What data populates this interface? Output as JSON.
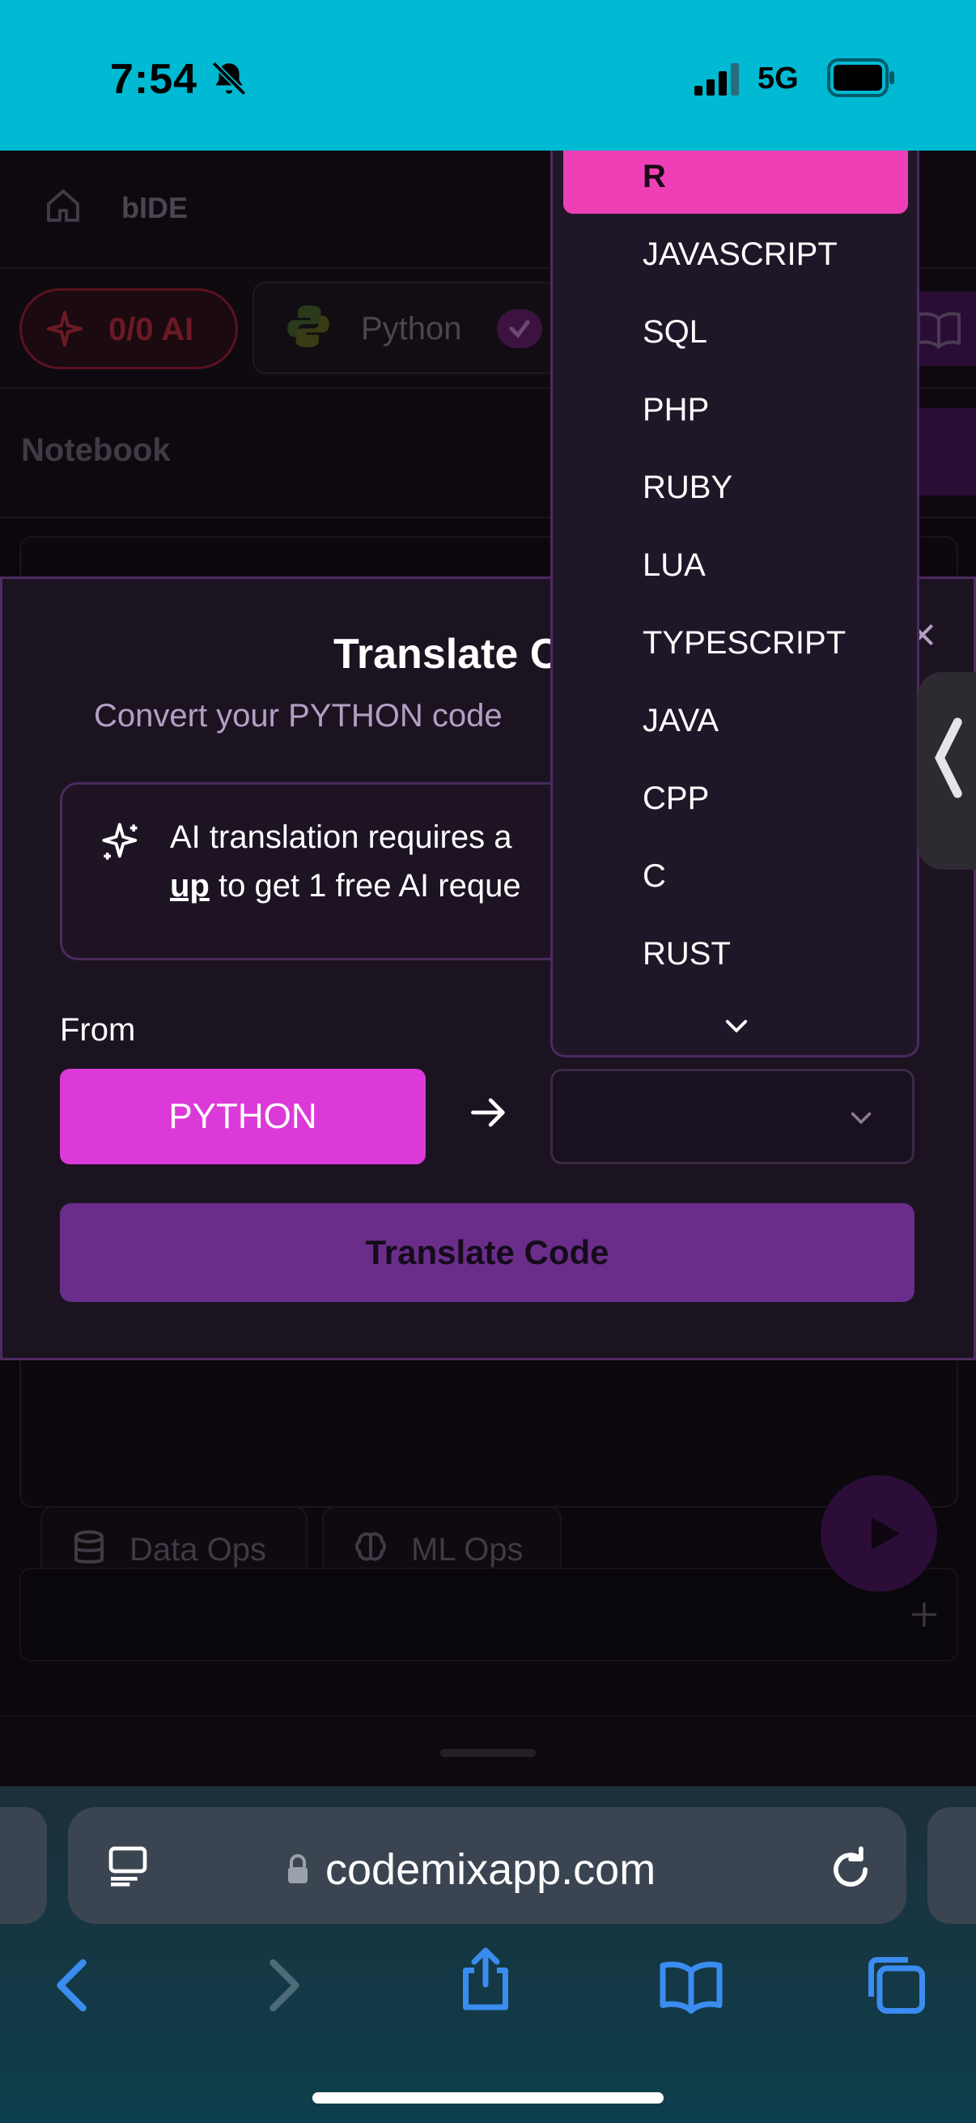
{
  "status_bar": {
    "time": "7:54",
    "network": "5G"
  },
  "app": {
    "title": "bIDE",
    "ai_counter": "0/0 AI",
    "language_chip": "Python",
    "notebook_title": "Notebook",
    "chips": {
      "data_ops": "Data Ops",
      "ml_ops": "ML Ops"
    }
  },
  "modal": {
    "title": "Translate C",
    "subtitle": "Convert your PYTHON code",
    "info_line_1": "AI translation requires a",
    "info_link": "up",
    "info_line_2_rest": " to get 1 free AI reque",
    "from_label": "From",
    "from_value": "PYTHON",
    "to_value": "",
    "translate_button": "Translate Code"
  },
  "dropdown": {
    "selected": "R",
    "items": [
      "JAVASCRIPT",
      "SQL",
      "PHP",
      "RUBY",
      "LUA",
      "TYPESCRIPT",
      "JAVA",
      "CPP",
      "C",
      "RUST"
    ]
  },
  "browser": {
    "url": "codemixapp.com"
  },
  "colors": {
    "status_bar": "#00b9d3",
    "accent_pink": "#db3ad8",
    "selected_item": "#ef3fb6",
    "translate_button": "#6a2d8a",
    "modal_bg": "#1c1321"
  },
  "icons": [
    "bell-slash-icon",
    "signal-icon",
    "battery-icon",
    "home-icon",
    "sparkle-icon",
    "python-icon",
    "check-icon",
    "book-icon",
    "close-icon",
    "arrow-right-icon",
    "chevron-down-icon",
    "chevron-left-icon",
    "database-icon",
    "brain-icon",
    "play-icon",
    "plus-icon",
    "reader-icon",
    "lock-icon",
    "reload-icon",
    "back-icon",
    "forward-icon",
    "share-icon",
    "bookmarks-icon",
    "tabs-icon"
  ]
}
